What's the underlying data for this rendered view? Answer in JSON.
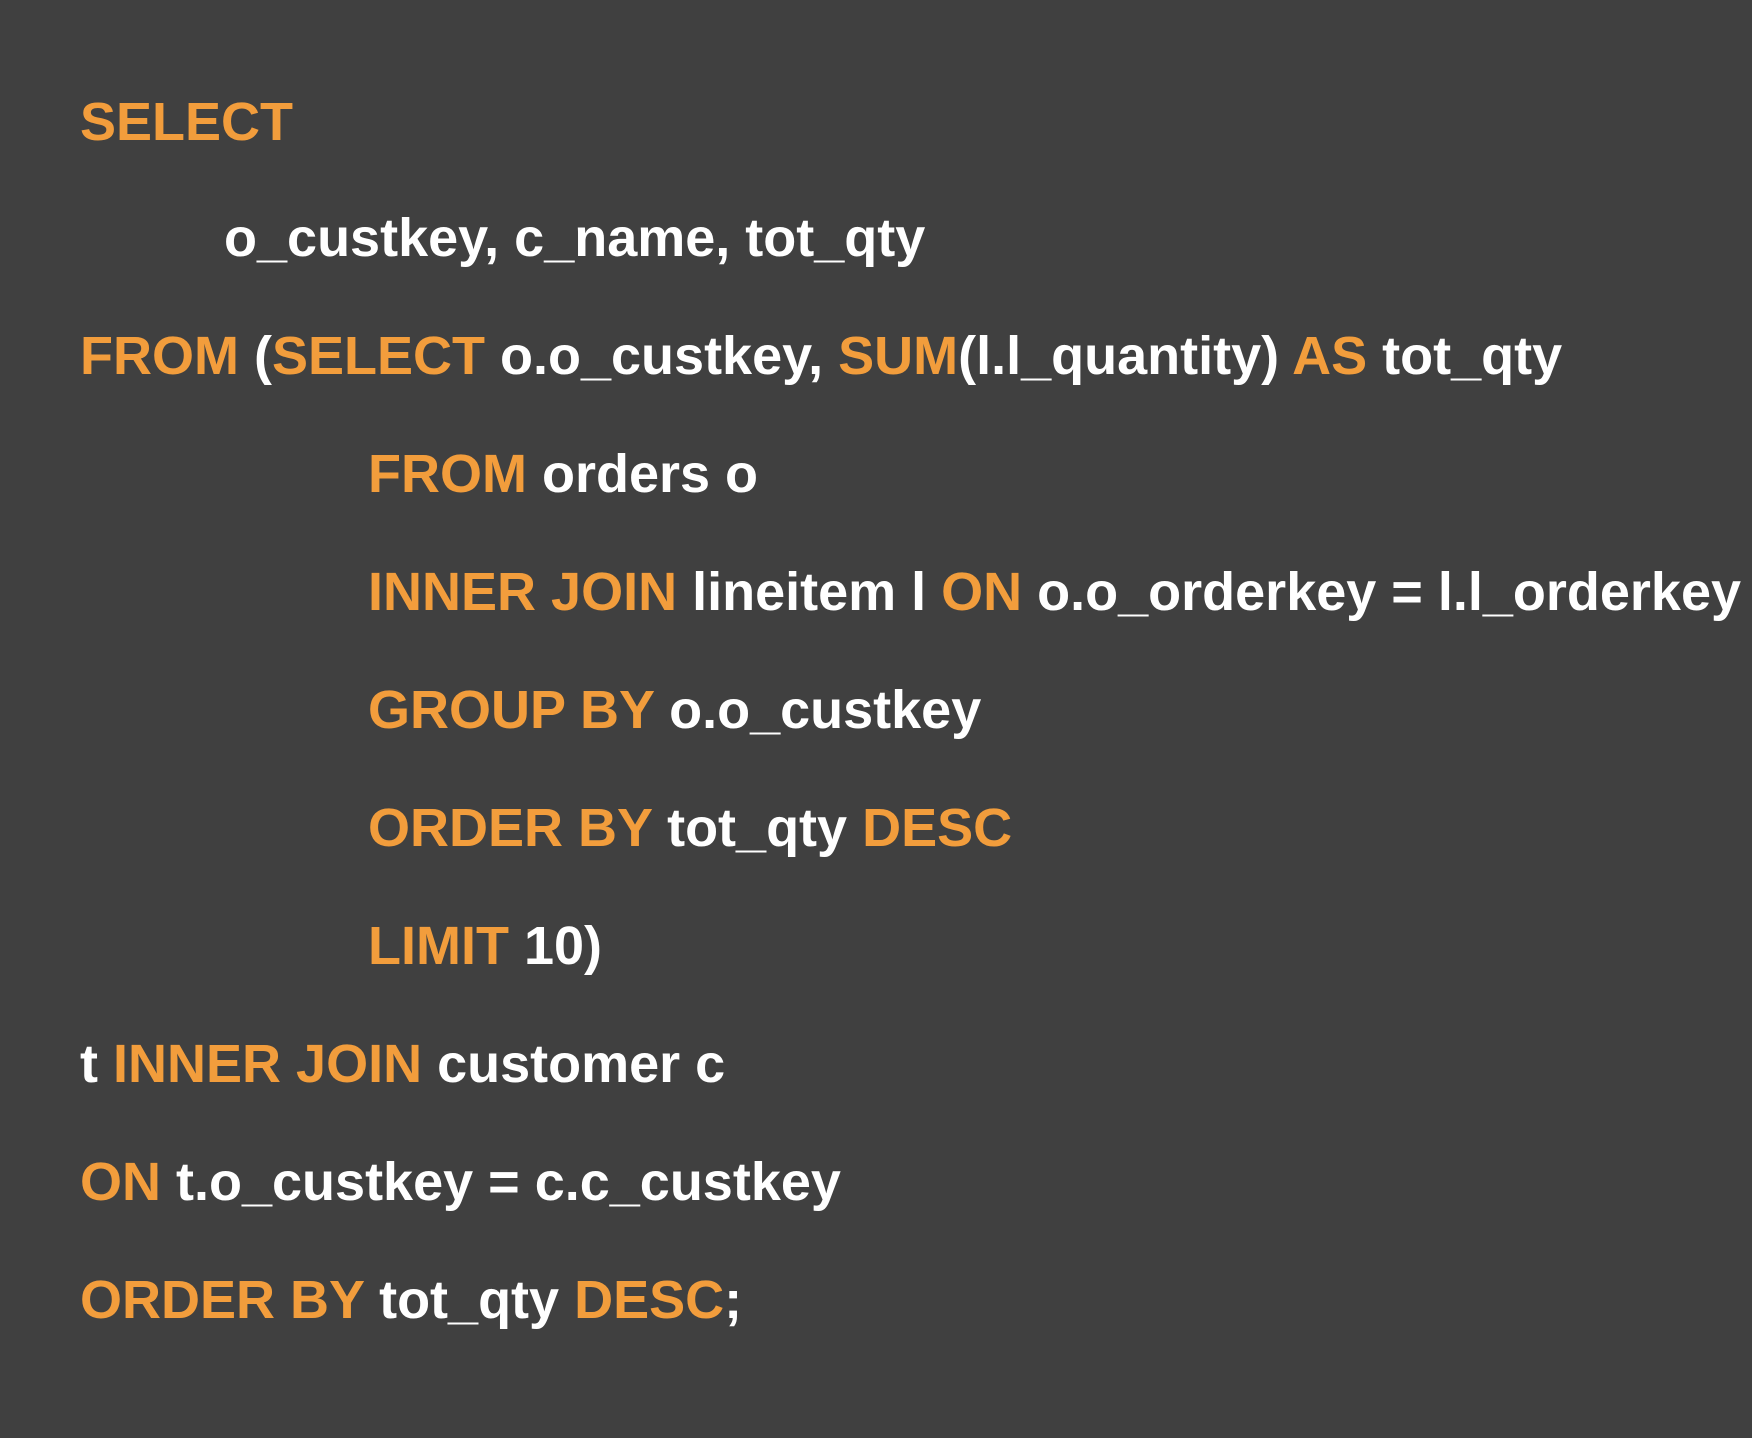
{
  "colors": {
    "background": "#404040",
    "keyword": "#f29d3c",
    "text": "#ffffff"
  },
  "lines": [
    {
      "tokens": [
        {
          "t": "SELECT",
          "kw": true
        }
      ]
    },
    {
      "tokens": [
        {
          "t": "o_custkey, c_name, tot_qty",
          "kw": false
        }
      ]
    },
    {
      "tokens": [
        {
          "t": "FROM",
          "kw": true
        },
        {
          "t": " (",
          "kw": false
        },
        {
          "t": "SELECT",
          "kw": true
        },
        {
          "t": " o.o_custkey, ",
          "kw": false
        },
        {
          "t": "SUM",
          "kw": true
        },
        {
          "t": "(l.l_quantity) ",
          "kw": false
        },
        {
          "t": "AS",
          "kw": true
        },
        {
          "t": " tot_qty",
          "kw": false
        }
      ]
    },
    {
      "tokens": [
        {
          "t": "FROM",
          "kw": true
        },
        {
          "t": " orders o",
          "kw": false
        }
      ]
    },
    {
      "tokens": [
        {
          "t": "INNER JOIN",
          "kw": true
        },
        {
          "t": " lineitem l ",
          "kw": false
        },
        {
          "t": "ON",
          "kw": true
        },
        {
          "t": " o.o_orderkey = l.l_orderkey",
          "kw": false
        }
      ]
    },
    {
      "tokens": [
        {
          "t": "GROUP BY",
          "kw": true
        },
        {
          "t": " o.o_custkey",
          "kw": false
        }
      ]
    },
    {
      "tokens": [
        {
          "t": "ORDER BY",
          "kw": true
        },
        {
          "t": " tot_qty ",
          "kw": false
        },
        {
          "t": "DESC",
          "kw": true
        }
      ]
    },
    {
      "tokens": [
        {
          "t": "LIMIT",
          "kw": true
        },
        {
          "t": " 10)",
          "kw": false
        }
      ]
    },
    {
      "tokens": [
        {
          "t": "t ",
          "kw": false
        },
        {
          "t": "INNER JOIN",
          "kw": true
        },
        {
          "t": " customer c",
          "kw": false
        }
      ]
    },
    {
      "tokens": [
        {
          "t": "ON",
          "kw": true
        },
        {
          "t": " t.o_custkey = c.c_custkey",
          "kw": false
        }
      ]
    },
    {
      "tokens": [
        {
          "t": "ORDER BY",
          "kw": true
        },
        {
          "t": " tot_qty ",
          "kw": false
        },
        {
          "t": "DESC",
          "kw": true
        },
        {
          "t": ";",
          "kw": false
        }
      ]
    }
  ]
}
